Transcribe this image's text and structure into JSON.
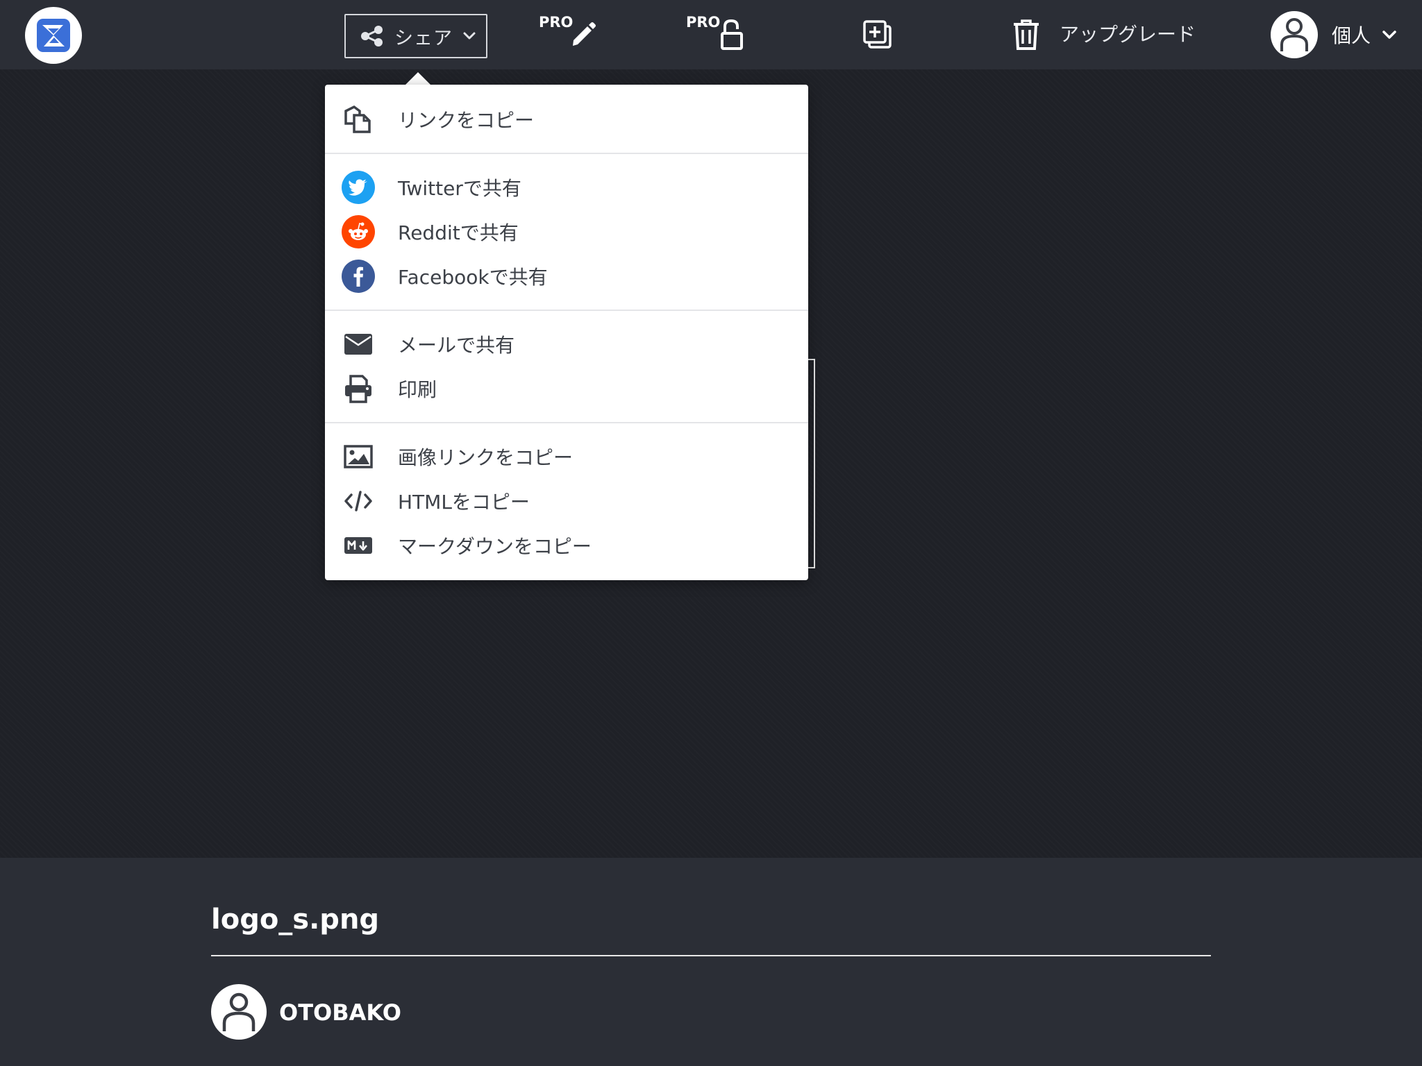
{
  "header": {
    "share_label": "シェア",
    "edit_pro_badge": "PRO",
    "lock_pro_badge": "PRO",
    "upgrade_label": "アップグレード",
    "account_label": "個人"
  },
  "share_menu": {
    "copy_link": "リンクをコピー",
    "twitter": "Twitterで共有",
    "reddit": "Redditで共有",
    "facebook": "Facebookで共有",
    "email": "メールで共有",
    "print": "印刷",
    "copy_image_link": "画像リンクをコピー",
    "copy_html": "HTMLをコピー",
    "copy_markdown": "マークダウンをコピー"
  },
  "file": {
    "name": "logo_s.png",
    "owner": "OTOBAKO"
  },
  "colors": {
    "topbar": "#2b2e36",
    "viewer": "#1f2127",
    "twitter": "#1da1f2",
    "reddit": "#ff4500",
    "facebook": "#3b5998",
    "logo_blue": "#3b6fd8",
    "menu_text": "#3d4148"
  },
  "icons": {
    "logo": "app-logo",
    "share": "share-nodes-icon",
    "edit": "pencil-icon",
    "lock": "unlock-icon",
    "duplicate": "duplicate-plus-icon",
    "delete": "trash-icon",
    "user": "user-icon",
    "chevron": "chevron-down-icon"
  }
}
